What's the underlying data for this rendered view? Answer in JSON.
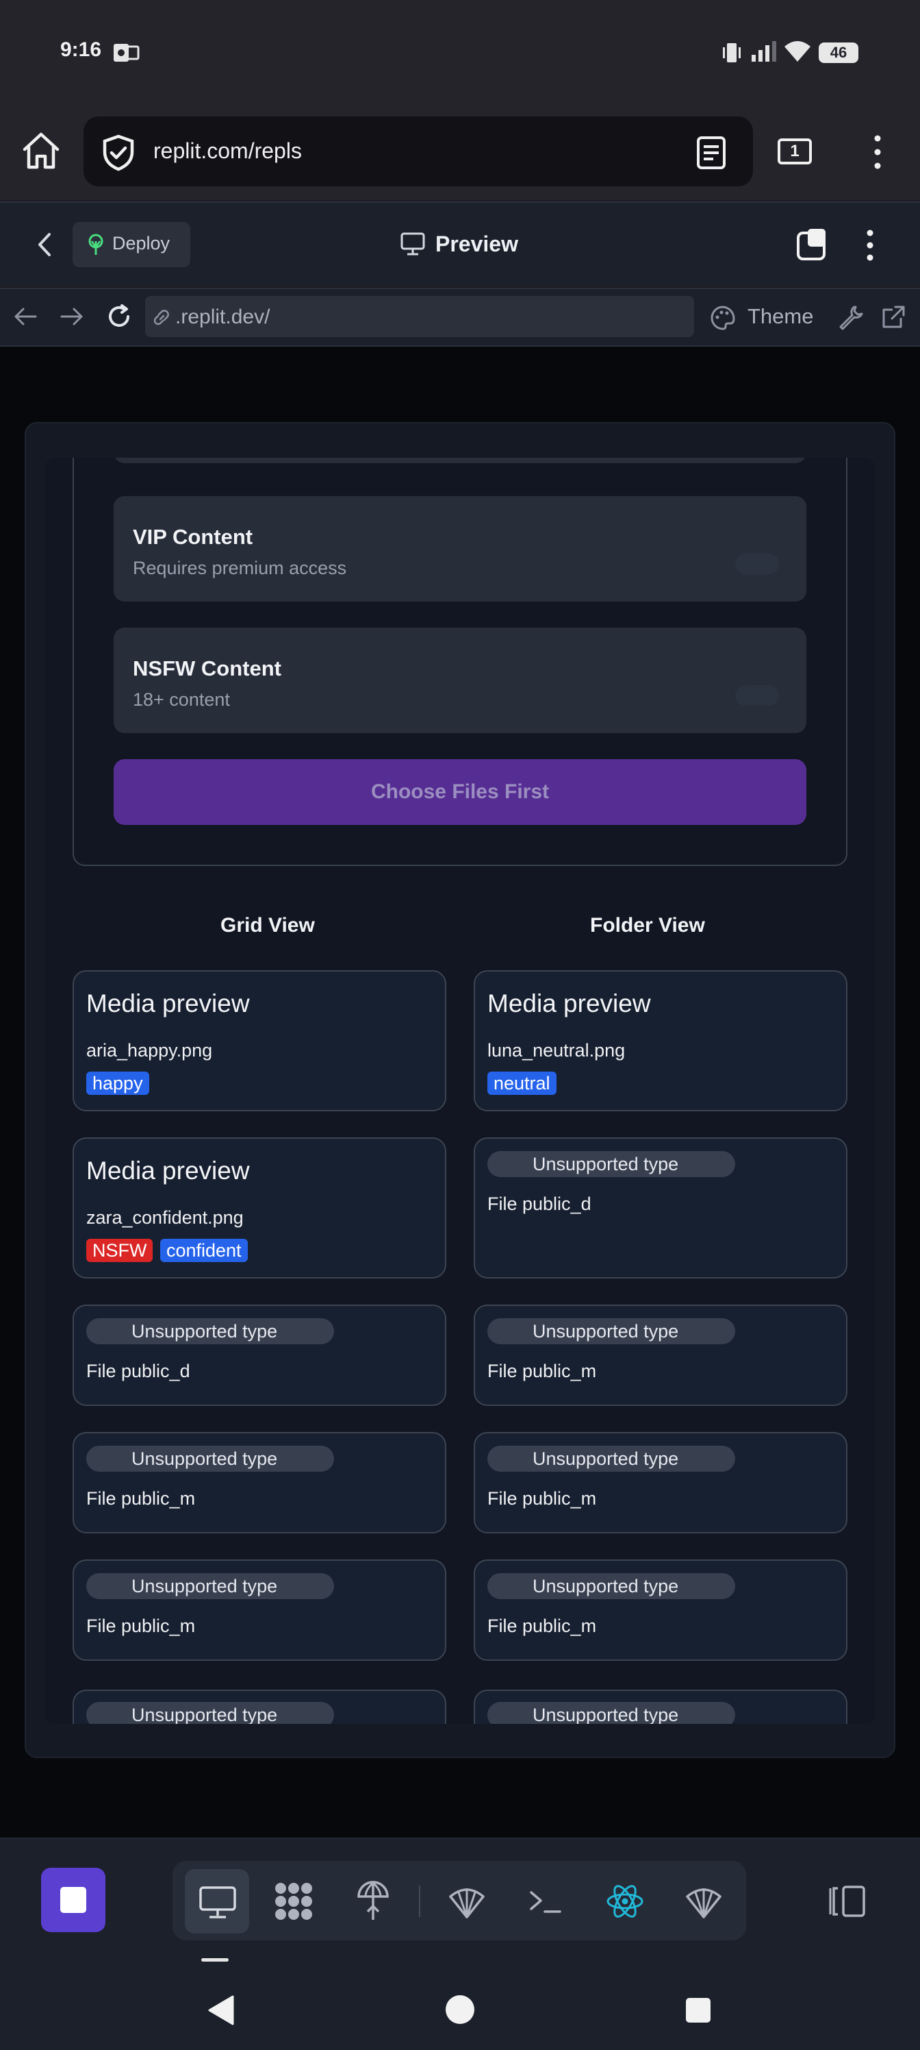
{
  "status_bar": {
    "time": "9:16",
    "battery": "46"
  },
  "browser": {
    "url": "replit.com/repls",
    "tabs_count": "1"
  },
  "replit_header": {
    "deploy_label": "Deploy",
    "preview_title": "Preview"
  },
  "webview": {
    "url": ".replit.dev/",
    "theme_label": "Theme"
  },
  "upload": {
    "options": [
      {
        "title": "VIP Content",
        "subtitle": "Requires premium access"
      },
      {
        "title": "NSFW Content",
        "subtitle": "18+ content"
      }
    ],
    "choose_button": "Choose Files First"
  },
  "views": {
    "grid_label": "Grid View",
    "folder_label": "Folder View"
  },
  "grid_cards": [
    {
      "title": "Media preview",
      "file": "aria_happy.png",
      "tags": [
        "happy"
      ]
    },
    {
      "title": "Media preview",
      "file": "zara_confident.png",
      "tags": [
        "NSFW",
        "confident"
      ]
    },
    {
      "badge": "Unsupported type",
      "file": "File public_d"
    },
    {
      "badge": "Unsupported type",
      "file": "File public_m"
    },
    {
      "badge": "Unsupported type",
      "file": "File public_m"
    },
    {
      "badge": "Unsupported type"
    }
  ],
  "folder_cards": [
    {
      "title": "Media preview",
      "file": "luna_neutral.png",
      "tags": [
        "neutral"
      ]
    },
    {
      "badge": "Unsupported type",
      "file": "File public_d"
    },
    {
      "badge": "Unsupported type",
      "file": "File public_m"
    },
    {
      "badge": "Unsupported type",
      "file": "File public_m"
    },
    {
      "badge": "Unsupported type",
      "file": "File public_m"
    },
    {
      "badge": "Unsupported type"
    }
  ],
  "toolbar_icons": [
    "monitor-icon",
    "packages-icon",
    "deploy-icon",
    "shell-icon",
    "terminal-icon",
    "react-icon",
    "shell-icon-2",
    "split-view-icon"
  ],
  "colors": {
    "accent_purple": "#5a3fd1",
    "button_purple": "#562e93",
    "tag_blue": "#2563eb",
    "tag_red": "#dc2626",
    "react_cyan": "#22b8d8"
  }
}
